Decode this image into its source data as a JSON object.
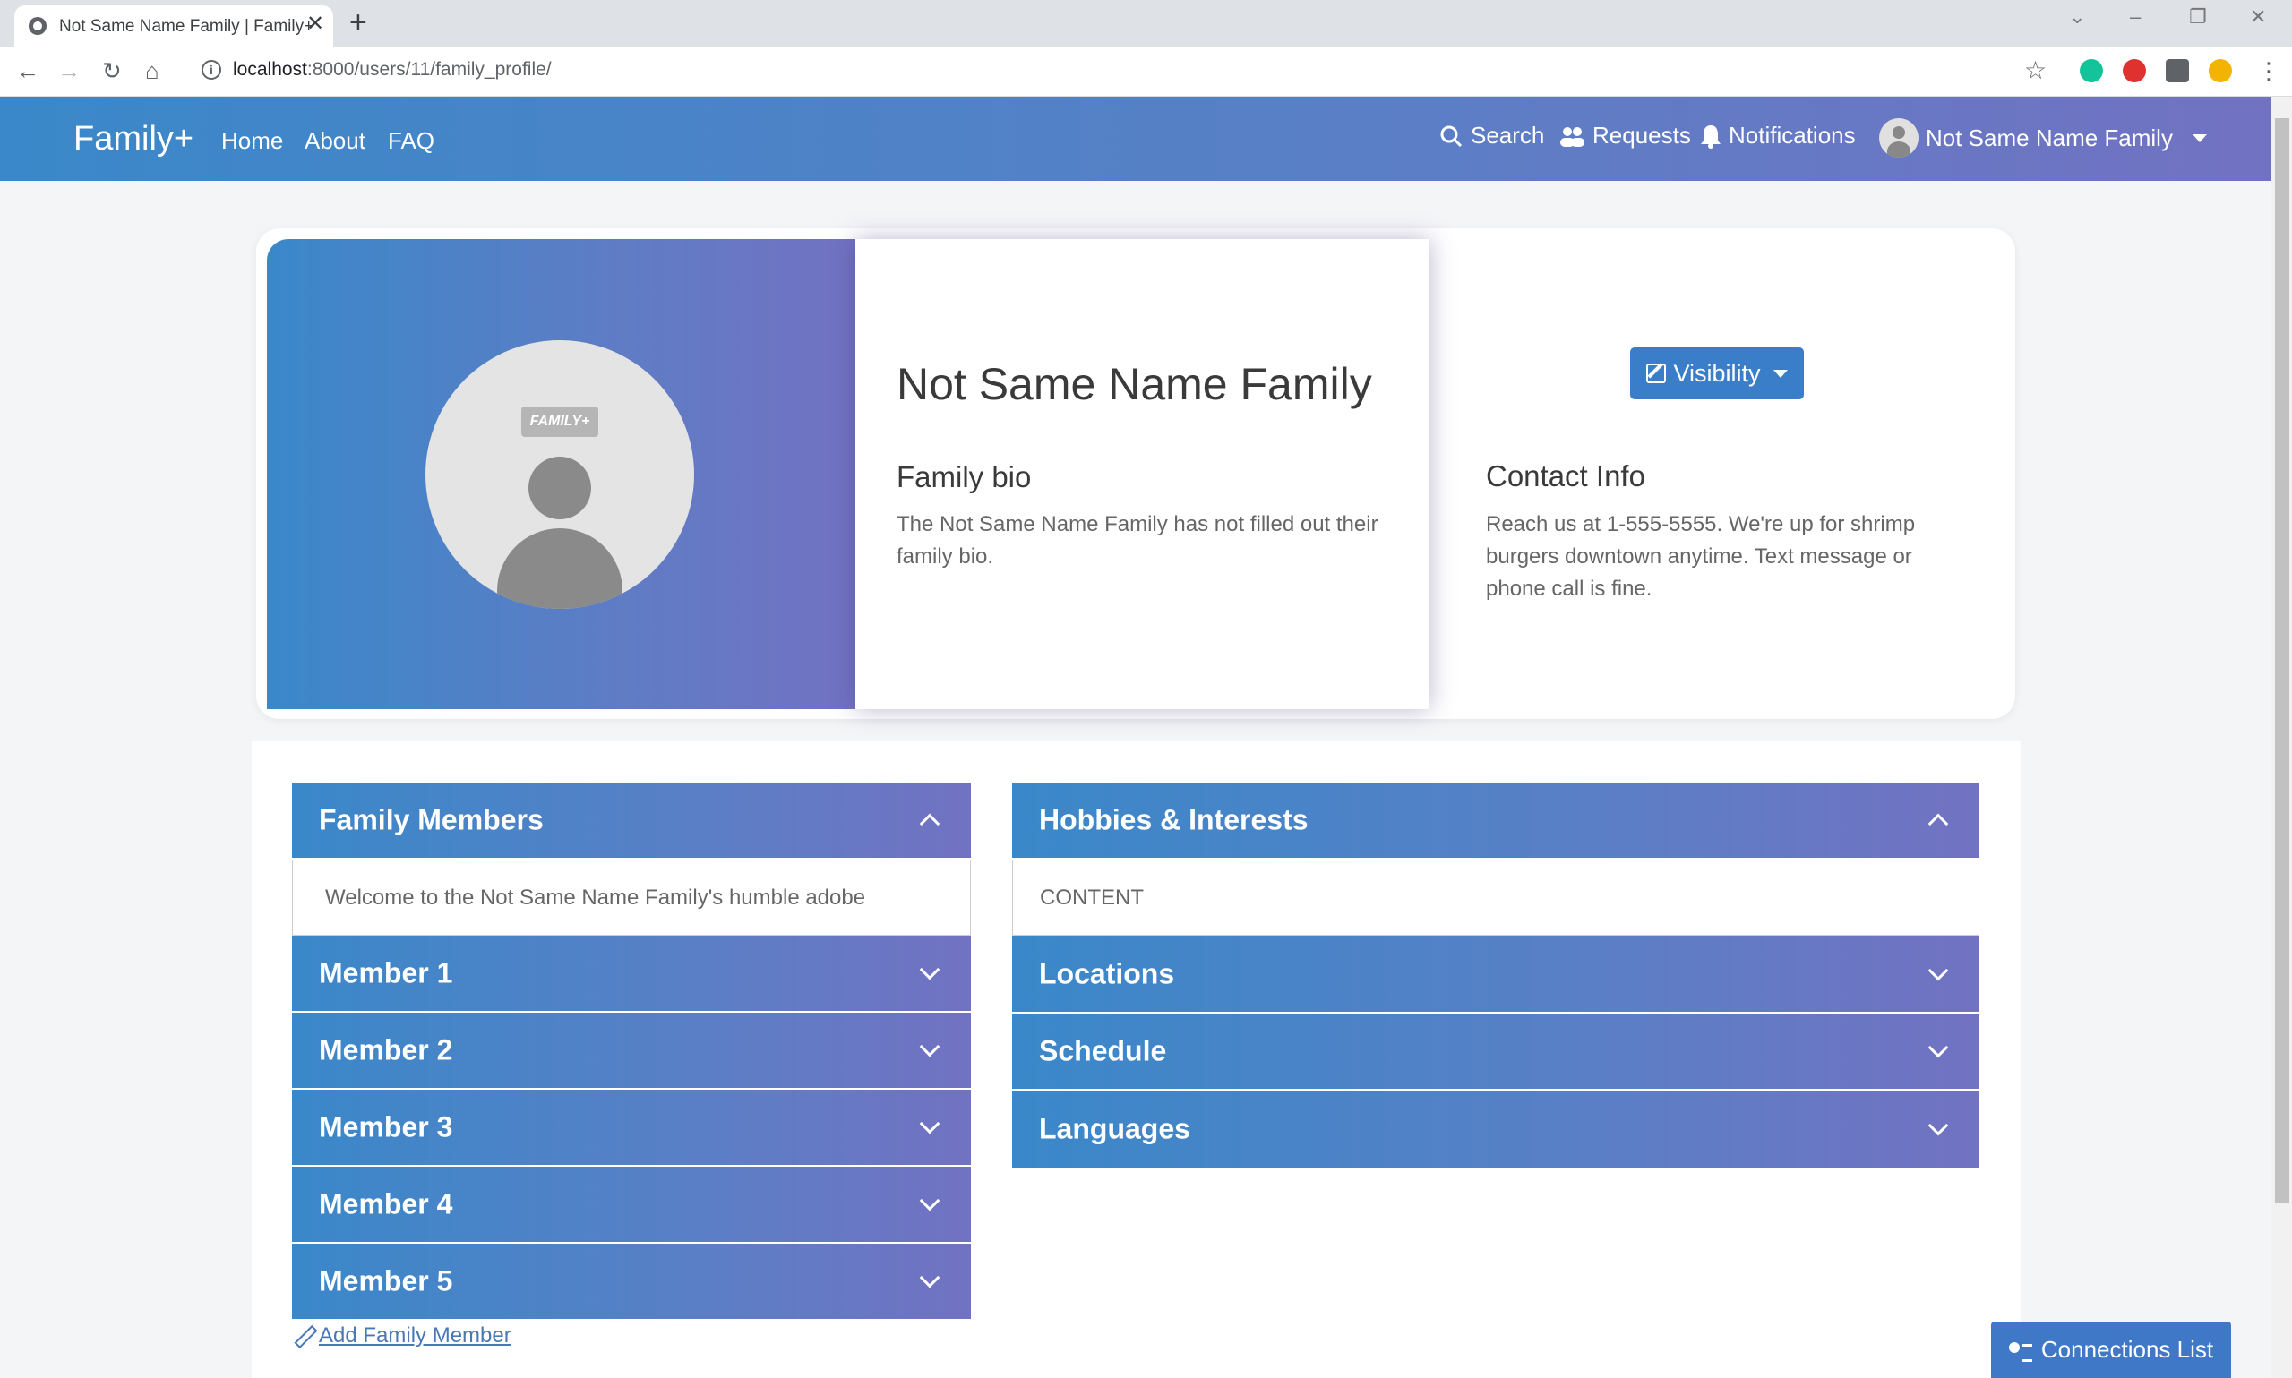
{
  "browser": {
    "tab_title": "Not Same Name Family | Family+",
    "tab_close": "✕",
    "new_tab": "+",
    "url_host": "localhost",
    "url_path": ":8000/users/11/family_profile/"
  },
  "nav": {
    "brand": "Family+",
    "links": [
      "Home",
      "About",
      "FAQ"
    ],
    "search": "Search",
    "requests": "Requests",
    "notifications": "Notifications",
    "user": "Not Same Name Family"
  },
  "profile": {
    "avatar_logo": "FAMILY+",
    "name": "Not Same Name Family",
    "bio_heading": "Family bio",
    "bio_text": "The Not Same Name Family has not filled out their family bio.",
    "visibility_label": "Visibility",
    "contact_heading": "Contact Info",
    "contact_text": "Reach us at 1-555-5555. We're up for shrimp burgers downtown anytime. Text message or phone call is fine."
  },
  "members": {
    "header": "Family Members",
    "welcome": "Welcome to the Not Same Name Family's humble adobe",
    "items": [
      "Member 1",
      "Member 2",
      "Member 3",
      "Member 4",
      "Member 5"
    ],
    "add_label": "Add Family Member"
  },
  "interests": {
    "header": "Hobbies & Interests",
    "content": "CONTENT",
    "items": [
      "Locations",
      "Schedule",
      "Languages"
    ]
  },
  "connections_label": "Connections List",
  "colors": {
    "gradient_start": "#3a88c9",
    "gradient_end": "#7272c2",
    "button": "#3a7dc9"
  }
}
